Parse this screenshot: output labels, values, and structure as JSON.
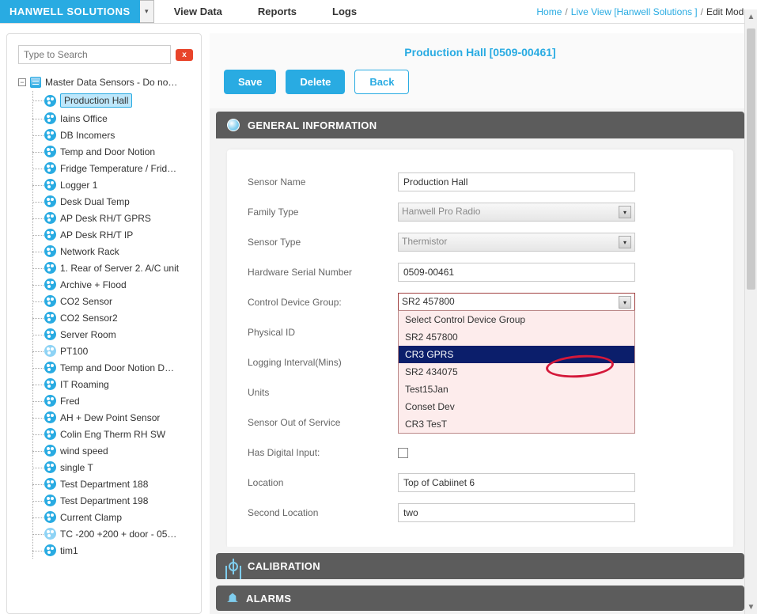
{
  "brand": "HANWELL SOLUTIONS",
  "menu": {
    "view_data": "View Data",
    "reports": "Reports",
    "logs": "Logs"
  },
  "breadcrumb": {
    "home": "Home",
    "live": "Live View [Hanwell Solutions ]",
    "current": "Edit Mode"
  },
  "search": {
    "placeholder": "Type to Search",
    "clear": "x"
  },
  "tree": {
    "root": "Master Data Sensors - Do not…",
    "items": [
      "Production Hall",
      "Iains Office",
      "DB Incomers",
      "Temp and Door Notion",
      "Fridge Temperature / Frid…",
      "Logger 1",
      "Desk Dual Temp",
      "AP Desk RH/T GPRS",
      "AP Desk RH/T IP",
      "Network Rack",
      "1. Rear of Server 2. A/C unit",
      "Archive + Flood",
      "CO2 Sensor",
      "CO2 Sensor2",
      "Server Room",
      "PT100",
      "Temp and Door Notion D…",
      "IT Roaming",
      "Fred",
      "AH + Dew Point Sensor",
      "Colin Eng Therm RH SW",
      "wind speed",
      "single T",
      "Test Department 188",
      "Test Department 198",
      "Current Clamp",
      "TC -200 +200 + door - 05…",
      "tim1"
    ],
    "selected_index": 0,
    "light_indices": [
      15,
      26
    ]
  },
  "main": {
    "title": "Production Hall [0509-00461]",
    "buttons": {
      "save": "Save",
      "delete": "Delete",
      "back": "Back"
    },
    "panels": {
      "general": "GENERAL INFORMATION",
      "calibration": "CALIBRATION",
      "alarms": "ALARMS"
    },
    "form": {
      "sensor_name": {
        "label": "Sensor Name",
        "value": "Production Hall"
      },
      "family_type": {
        "label": "Family Type",
        "value": "Hanwell Pro Radio"
      },
      "sensor_type": {
        "label": "Sensor Type",
        "value": "Thermistor"
      },
      "serial": {
        "label": "Hardware Serial Number",
        "value": "0509-00461"
      },
      "control_group": {
        "label": "Control Device Group:",
        "value": "SR2 457800",
        "options": [
          "Select Control Device Group",
          "SR2 457800",
          "CR3 GPRS",
          "SR2 434075",
          "Test15Jan",
          "Conset Dev",
          "CR3 TesT"
        ],
        "highlight_index": 2
      },
      "physical_id": {
        "label": "Physical ID"
      },
      "logging_interval": {
        "label": "Logging Interval(Mins)"
      },
      "units": {
        "label": "Units"
      },
      "out_of_service": {
        "label": "Sensor Out of Service"
      },
      "has_digital": {
        "label": "Has Digital Input:"
      },
      "location": {
        "label": "Location",
        "value": "Top of Cabiinet 6"
      },
      "second_location": {
        "label": "Second Location",
        "value": "two"
      }
    }
  }
}
